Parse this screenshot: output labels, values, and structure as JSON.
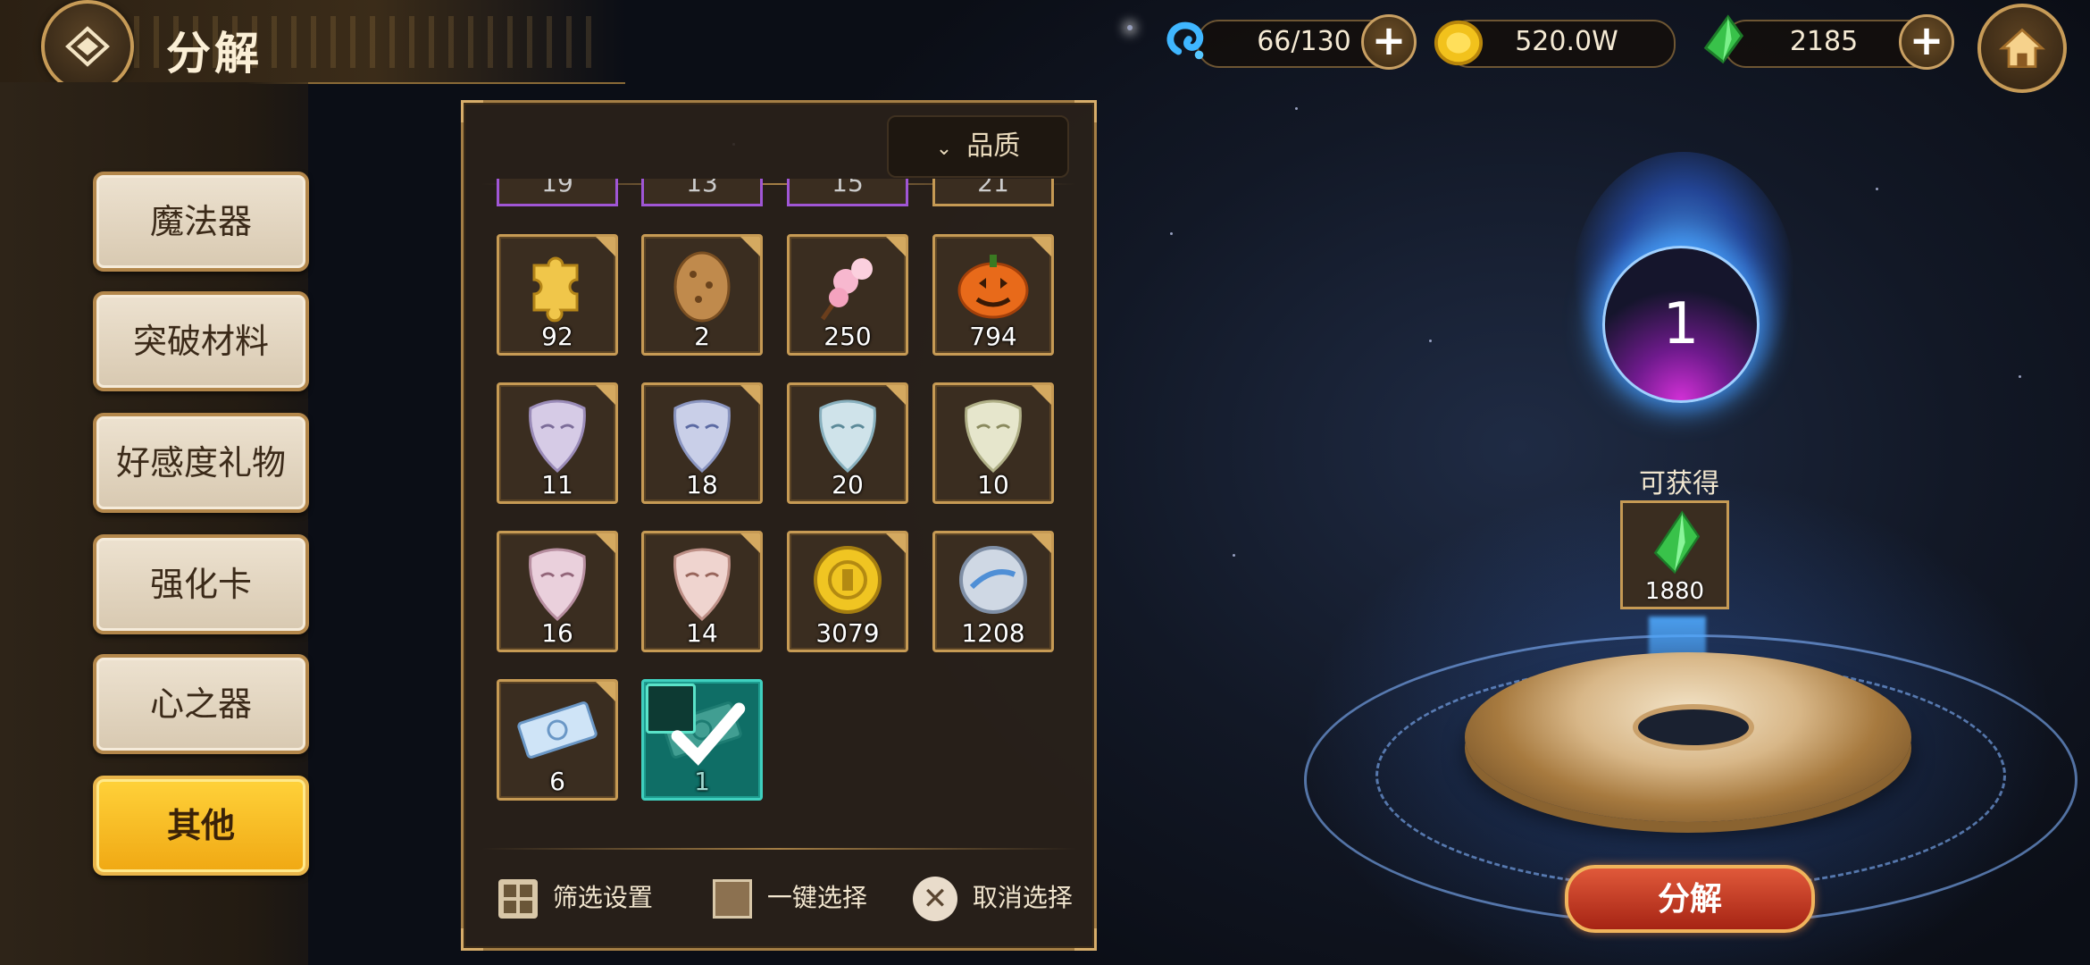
{
  "header": {
    "title": "分解"
  },
  "resources": {
    "stamina": "66/130",
    "gold": "520.0W",
    "gem": "2185"
  },
  "categories": [
    {
      "label": "魔法器",
      "active": false
    },
    {
      "label": "突破材料",
      "active": false
    },
    {
      "label": "好感度礼物",
      "active": false
    },
    {
      "label": "强化卡",
      "active": false
    },
    {
      "label": "心之器",
      "active": false
    },
    {
      "label": "其他",
      "active": true
    }
  ],
  "filter": {
    "label": "品质"
  },
  "partial_row": [
    "19",
    "13",
    "15",
    "21"
  ],
  "items": [
    {
      "icon": "puzzle-icon",
      "count": "92"
    },
    {
      "icon": "egg-icon",
      "count": "2"
    },
    {
      "icon": "sakura-branch-icon",
      "count": "250"
    },
    {
      "icon": "pumpkin-icon",
      "count": "794"
    },
    {
      "icon": "mask-lilac-icon",
      "count": "11"
    },
    {
      "icon": "mask-blue-icon",
      "count": "18"
    },
    {
      "icon": "mask-cyan-icon",
      "count": "20"
    },
    {
      "icon": "mask-cream-icon",
      "count": "10"
    },
    {
      "icon": "mask-pink-icon",
      "count": "16"
    },
    {
      "icon": "mask-rose-icon",
      "count": "14"
    },
    {
      "icon": "gold-coin-icon",
      "count": "3079"
    },
    {
      "icon": "silver-coin-icon",
      "count": "1208"
    },
    {
      "icon": "ticket-icon",
      "count": "6"
    },
    {
      "icon": "ticket-selected-icon",
      "count": "1",
      "selected": true
    }
  ],
  "actions": {
    "filter_settings": "筛选设置",
    "select_all": "一键选择",
    "cancel_select": "取消选择"
  },
  "result": {
    "selected_count": "1",
    "obtain_label": "可获得",
    "reward_count": "1880",
    "decompose_button": "分解"
  }
}
